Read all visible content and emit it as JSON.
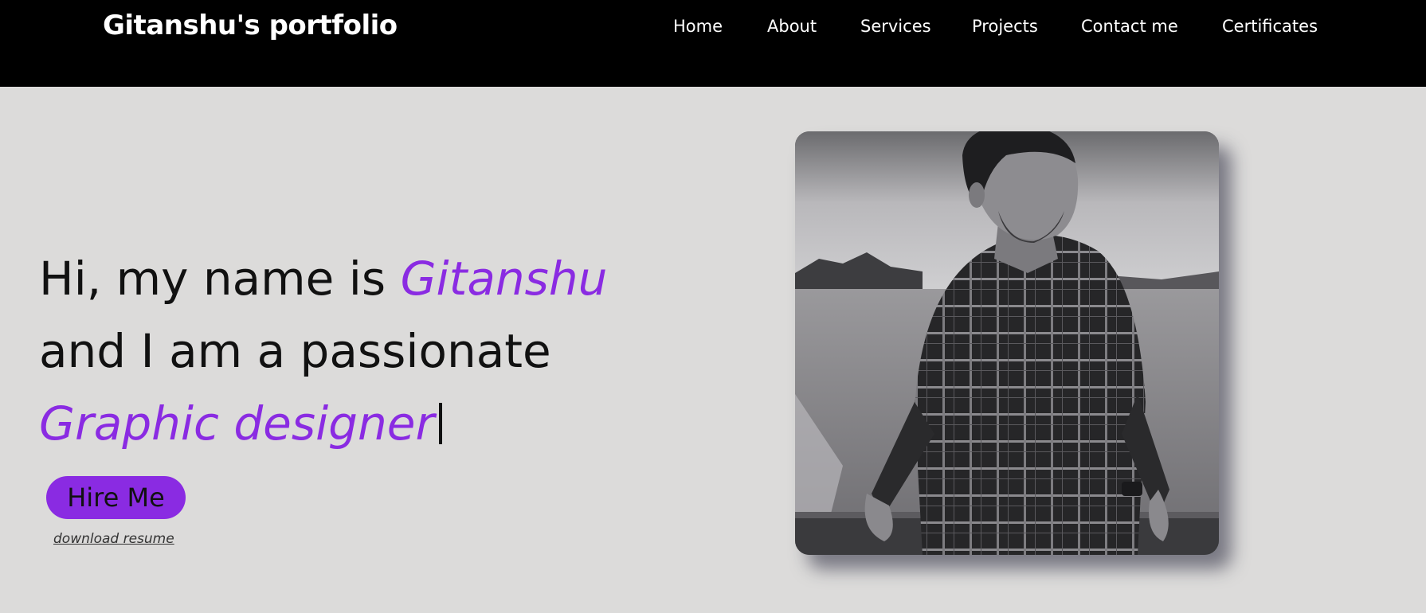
{
  "header": {
    "brand": "Gitanshu's portfolio",
    "nav": [
      {
        "label": "Home"
      },
      {
        "label": "About"
      },
      {
        "label": "Services"
      },
      {
        "label": "Projects"
      },
      {
        "label": "Contact me"
      },
      {
        "label": "Certificates"
      }
    ]
  },
  "hero": {
    "intro": "Hi, my name is ",
    "name": "Gitanshu",
    "line2": "and I am a passionate",
    "role": "Graphic designer",
    "hire_label": "Hire Me",
    "resume_label": "download resume"
  },
  "colors": {
    "accent": "#8a2be2",
    "navbar_bg": "#000000",
    "page_bg": "#dcdbda"
  }
}
